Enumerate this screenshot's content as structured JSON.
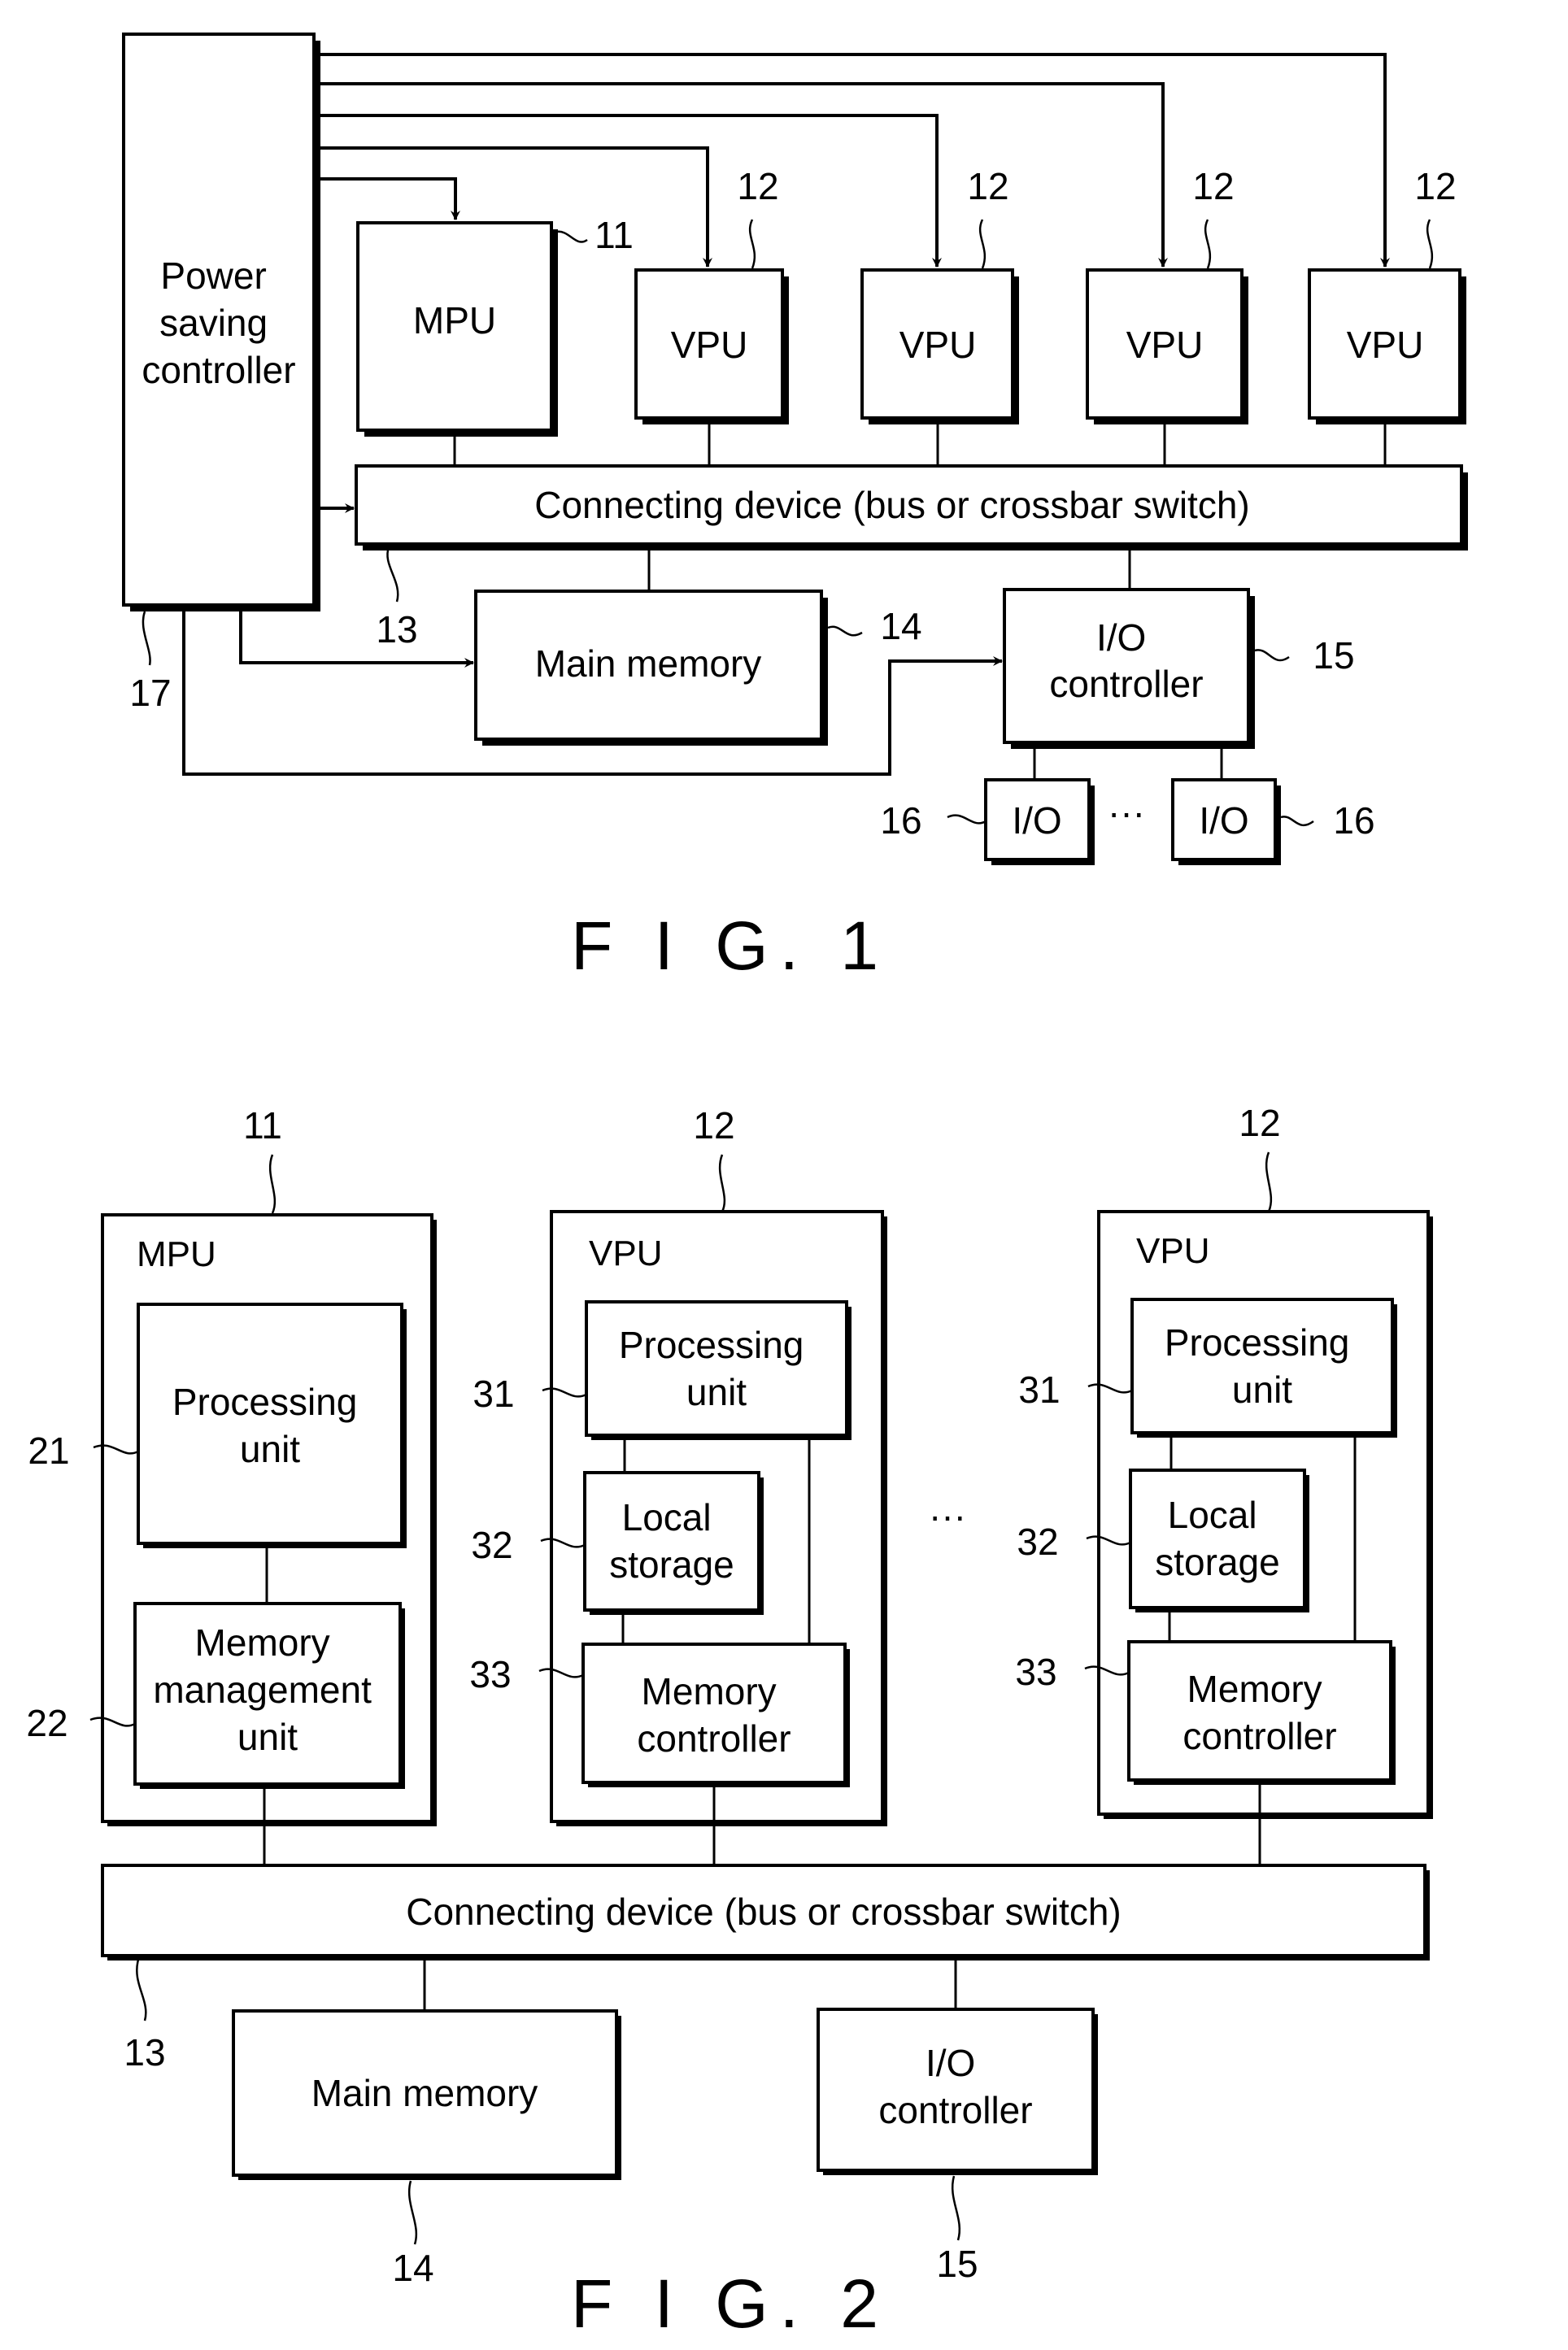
{
  "fig1": {
    "caption": "F I G. 1",
    "power_controller": {
      "lines": [
        "Power",
        "saving",
        "controller"
      ],
      "ref": "17"
    },
    "mpu": {
      "label": "MPU",
      "ref": "11"
    },
    "vpus": [
      {
        "label": "VPU",
        "ref": "12"
      },
      {
        "label": "VPU",
        "ref": "12"
      },
      {
        "label": "VPU",
        "ref": "12"
      },
      {
        "label": "VPU",
        "ref": "12"
      }
    ],
    "connecting_device": {
      "label": "Connecting device (bus or crossbar switch)",
      "ref": "13"
    },
    "main_memory": {
      "label": "Main memory",
      "ref": "14"
    },
    "io_controller": {
      "lines": [
        "I/O",
        "controller"
      ],
      "ref": "15"
    },
    "io_devices": [
      {
        "label": "I/O",
        "ref": "16"
      },
      {
        "label": "I/O",
        "ref": "16"
      }
    ],
    "ellipsis": "···"
  },
  "fig2": {
    "caption": "F I G. 2",
    "mpu": {
      "label": "MPU",
      "ref": "11",
      "processing_unit": {
        "lines": [
          "Processing",
          "unit"
        ],
        "ref": "21"
      },
      "memory_management_unit": {
        "lines": [
          "Memory",
          "management",
          "unit"
        ],
        "ref": "22"
      }
    },
    "vpus": [
      {
        "label": "VPU",
        "ref": "12",
        "processing_unit": {
          "lines": [
            "Processing",
            "unit"
          ],
          "ref": "31"
        },
        "local_storage": {
          "lines": [
            "Local",
            "storage"
          ],
          "ref": "32"
        },
        "memory_controller": {
          "lines": [
            "Memory",
            "controller"
          ],
          "ref": "33"
        }
      },
      {
        "label": "VPU",
        "ref": "12",
        "processing_unit": {
          "lines": [
            "Processing",
            "unit"
          ],
          "ref": "31"
        },
        "local_storage": {
          "lines": [
            "Local",
            "storage"
          ],
          "ref": "32"
        },
        "memory_controller": {
          "lines": [
            "Memory",
            "controller"
          ],
          "ref": "33"
        }
      }
    ],
    "ellipsis": "···",
    "connecting_device": {
      "label": "Connecting device (bus or crossbar switch)",
      "ref": "13"
    },
    "main_memory": {
      "label": "Main memory",
      "ref": "14"
    },
    "io_controller": {
      "lines": [
        "I/O",
        "controller"
      ],
      "ref": "15"
    }
  }
}
